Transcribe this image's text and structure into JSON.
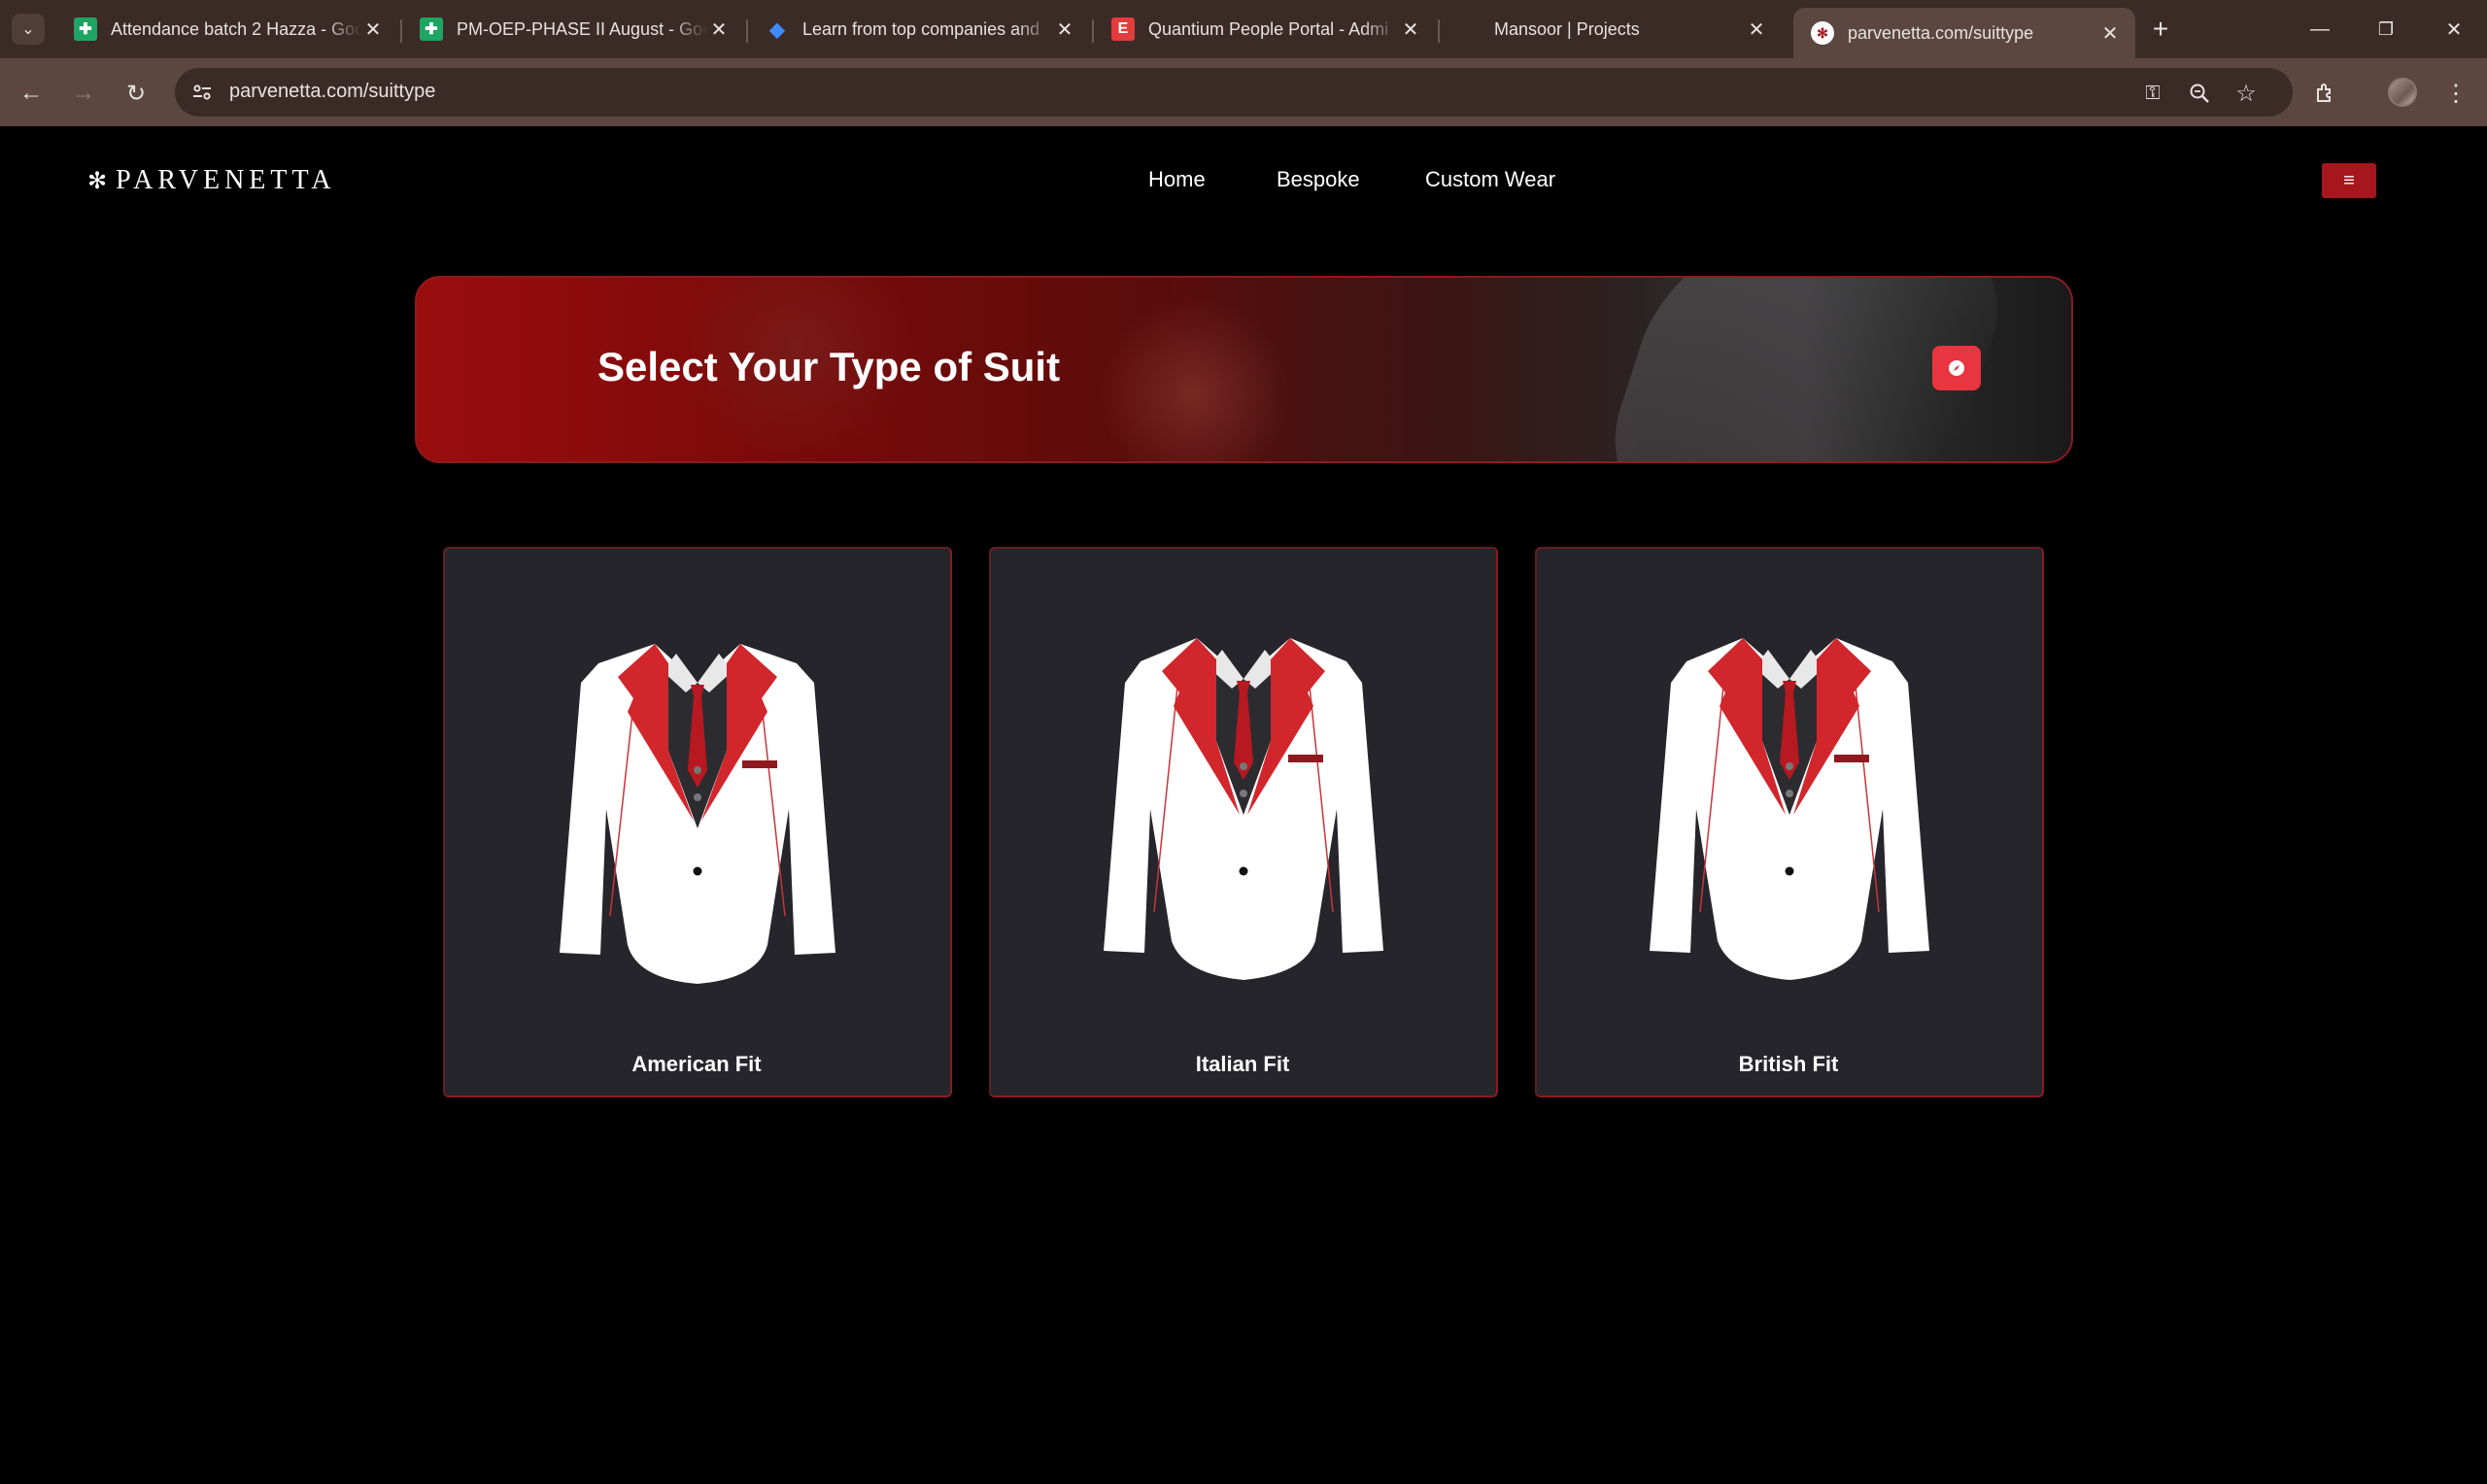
{
  "browser": {
    "tabs": [
      {
        "title": "Attendance batch 2 Hazza - Goo",
        "favicon": "sheets-icon"
      },
      {
        "title": "PM-OEP-PHASE II August - Goo",
        "favicon": "sheets-icon"
      },
      {
        "title": "Learn from top companies and",
        "favicon": "diamond-icon"
      },
      {
        "title": "Quantium People Portal - Admi",
        "favicon": "e-icon"
      },
      {
        "title": "Mansoor | Projects",
        "favicon": ""
      },
      {
        "title": "parvenetta.com/suittype",
        "favicon": "site-icon"
      }
    ],
    "url": "parvenetta.com/suittype"
  },
  "site": {
    "logo": "PARVENETTA",
    "nav": [
      "Home",
      "Bespoke",
      "Custom Wear"
    ],
    "banner_title": "Select Your Type of Suit",
    "cards": [
      {
        "label": "American Fit"
      },
      {
        "label": "Italian Fit"
      },
      {
        "label": "British Fit"
      }
    ]
  },
  "colors": {
    "accent": "#a5161d",
    "banner_button": "#e8353f",
    "card_bg": "#25252b",
    "page_bg": "#000000"
  }
}
